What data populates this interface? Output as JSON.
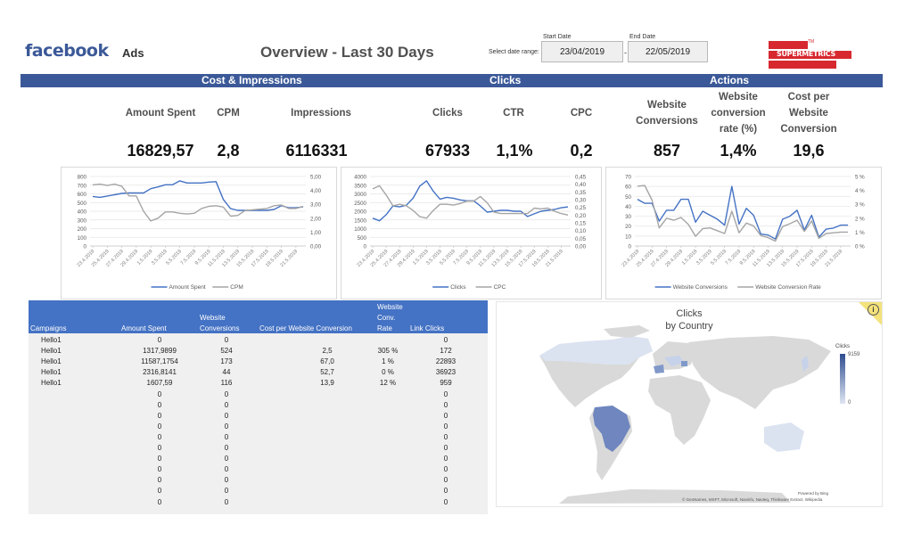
{
  "header": {
    "logo_text": "facebook",
    "product": "Ads",
    "title": "Overview - Last 30 Days",
    "date_range_label": "Select date range:",
    "start_date_label": "Start Date",
    "end_date_label": "End Date",
    "start_date": "23/04/2019",
    "end_date": "22/05/2019",
    "separator": "-",
    "partner_logo": "SUPERMETRICS",
    "partner_tm": "TM"
  },
  "sections": [
    "Cost & Impressions",
    "Clicks",
    "Actions"
  ],
  "kpis": [
    {
      "label": "Amount Spent",
      "value": "16829,57"
    },
    {
      "label": "CPM",
      "value": "2,8"
    },
    {
      "label": "Impressions",
      "value": "6116331"
    },
    {
      "label": "Clicks",
      "value": "67933"
    },
    {
      "label": "CTR",
      "value": "1,1%"
    },
    {
      "label": "CPC",
      "value": "0,2"
    },
    {
      "label": "Website Conversions",
      "value": "857"
    },
    {
      "label": "Website conversion rate (%)",
      "value": "1,4%"
    },
    {
      "label": "Cost per Website Conversion",
      "value": "19,6"
    }
  ],
  "colors": {
    "brand": "#3b5998",
    "series_primary": "#4472c4",
    "series_secondary": "#a5a5a5",
    "table_header": "#4472c4",
    "supermetrics_red": "#d7282f"
  },
  "chart_data": [
    {
      "type": "line",
      "title": "",
      "x_tick_labels": [
        "23.4.2019",
        "25.4.2019",
        "27.4.2019",
        "29.4.2019",
        "1.5.2019",
        "3.5.2019",
        "5.5.2019",
        "7.5.2019",
        "9.5.2019",
        "11.5.2019",
        "13.5.2019",
        "15.5.2019",
        "17.5.2019",
        "19.5.2019",
        "21.5.2019"
      ],
      "x": [
        "23.4.2019",
        "24.4.2019",
        "25.4.2019",
        "26.4.2019",
        "27.4.2019",
        "28.4.2019",
        "29.4.2019",
        "30.4.2019",
        "1.5.2019",
        "2.5.2019",
        "3.5.2019",
        "4.5.2019",
        "5.5.2019",
        "6.5.2019",
        "7.5.2019",
        "8.5.2019",
        "9.5.2019",
        "10.5.2019",
        "11.5.2019",
        "12.5.2019",
        "13.5.2019",
        "14.5.2019",
        "15.5.2019",
        "16.5.2019",
        "17.5.2019",
        "18.5.2019",
        "19.5.2019",
        "20.5.2019",
        "21.5.2019",
        "22.5.2019"
      ],
      "y_left": {
        "ticks": [
          "0",
          "100",
          "200",
          "300",
          "400",
          "500",
          "600",
          "700",
          "800"
        ],
        "range": [
          0,
          800
        ]
      },
      "y_right": {
        "ticks": [
          "0,00",
          "1,00",
          "2,00",
          "3,00",
          "4,00",
          "5,00"
        ],
        "range": [
          0,
          5
        ]
      },
      "legend": "bottom",
      "series": [
        {
          "name": "Amount Spent",
          "axis": "left",
          "values": [
            570,
            560,
            575,
            590,
            605,
            610,
            610,
            610,
            660,
            680,
            705,
            705,
            750,
            725,
            725,
            725,
            735,
            740,
            535,
            430,
            410,
            410,
            410,
            410,
            410,
            420,
            465,
            440,
            440,
            450
          ]
        },
        {
          "name": "CPM",
          "axis": "right",
          "values": [
            4.4,
            4.45,
            4.35,
            4.45,
            4.3,
            3.6,
            3.6,
            2.5,
            1.8,
            2.0,
            2.45,
            2.45,
            2.35,
            2.3,
            2.35,
            2.7,
            2.85,
            2.9,
            2.8,
            2.15,
            2.2,
            2.55,
            2.6,
            2.65,
            2.7,
            2.9,
            2.95,
            2.7,
            2.7,
            2.85
          ]
        }
      ]
    },
    {
      "type": "line",
      "title": "",
      "x_tick_labels": [
        "23.4.2019",
        "25.4.2019",
        "27.4.2019",
        "29.4.2019",
        "1.5.2019",
        "3.5.2019",
        "5.5.2019",
        "7.5.2019",
        "9.5.2019",
        "11.5.2019",
        "13.5.2019",
        "15.5.2019",
        "17.5.2019",
        "19.5.2019",
        "21.5.2019"
      ],
      "x": [
        "23.4.2019",
        "24.4.2019",
        "25.4.2019",
        "26.4.2019",
        "27.4.2019",
        "28.4.2019",
        "29.4.2019",
        "30.4.2019",
        "1.5.2019",
        "2.5.2019",
        "3.5.2019",
        "4.5.2019",
        "5.5.2019",
        "6.5.2019",
        "7.5.2019",
        "8.5.2019",
        "9.5.2019",
        "10.5.2019",
        "11.5.2019",
        "12.5.2019",
        "13.5.2019",
        "14.5.2019",
        "15.5.2019",
        "16.5.2019",
        "17.5.2019",
        "18.5.2019",
        "19.5.2019",
        "20.5.2019",
        "21.5.2019",
        "22.5.2019"
      ],
      "y_left": {
        "ticks": [
          "0",
          "500",
          "1000",
          "1500",
          "2000",
          "2500",
          "3000",
          "3500",
          "4000"
        ],
        "range": [
          0,
          4000
        ]
      },
      "y_right": {
        "ticks": [
          "0,00",
          "0,05",
          "0,10",
          "0,15",
          "0,20",
          "0,25",
          "0,30",
          "0,35",
          "0,40",
          "0,45"
        ],
        "range": [
          0,
          0.45
        ]
      },
      "legend": "bottom",
      "series": [
        {
          "name": "Clicks",
          "axis": "left",
          "values": [
            1600,
            1450,
            1800,
            2300,
            2250,
            2350,
            2750,
            3450,
            3750,
            3150,
            2700,
            2800,
            2750,
            2650,
            2600,
            2600,
            2300,
            1950,
            2000,
            2050,
            2050,
            2000,
            2000,
            1700,
            1850,
            2000,
            2050,
            2100,
            2200,
            2250
          ]
        },
        {
          "name": "CPC",
          "axis": "right",
          "values": [
            0.37,
            0.39,
            0.33,
            0.26,
            0.27,
            0.26,
            0.23,
            0.19,
            0.18,
            0.23,
            0.27,
            0.27,
            0.265,
            0.275,
            0.29,
            0.29,
            0.32,
            0.28,
            0.22,
            0.21,
            0.21,
            0.21,
            0.21,
            0.21,
            0.245,
            0.24,
            0.245,
            0.225,
            0.21,
            0.2
          ]
        }
      ]
    },
    {
      "type": "line",
      "title": "",
      "x_tick_labels": [
        "23.4.2019",
        "25.4.2019",
        "27.4.2019",
        "29.4.2019",
        "1.5.2019",
        "3.5.2019",
        "5.5.2019",
        "7.5.2019",
        "9.5.2019",
        "11.5.2019",
        "13.5.2019",
        "15.5.2019",
        "17.5.2019",
        "19.5.2019",
        "21.5.2019"
      ],
      "x": [
        "23.4.2019",
        "24.4.2019",
        "25.4.2019",
        "26.4.2019",
        "27.4.2019",
        "28.4.2019",
        "29.4.2019",
        "30.4.2019",
        "1.5.2019",
        "2.5.2019",
        "3.5.2019",
        "4.5.2019",
        "5.5.2019",
        "6.5.2019",
        "7.5.2019",
        "8.5.2019",
        "9.5.2019",
        "10.5.2019",
        "11.5.2019",
        "12.5.2019",
        "13.5.2019",
        "14.5.2019",
        "15.5.2019",
        "16.5.2019",
        "17.5.2019",
        "18.5.2019",
        "19.5.2019",
        "20.5.2019",
        "21.5.2019",
        "22.5.2019"
      ],
      "y_left": {
        "ticks": [
          "0",
          "10",
          "20",
          "30",
          "40",
          "50",
          "60",
          "70"
        ],
        "range": [
          0,
          70
        ]
      },
      "y_right": {
        "ticks": [
          "0 %",
          "1 %",
          "2 %",
          "3 %",
          "4 %",
          "5 %"
        ],
        "range": [
          0,
          5
        ]
      },
      "legend": "bottom",
      "series": [
        {
          "name": "Website Conversions",
          "axis": "left",
          "values": [
            47,
            43,
            43,
            25,
            36,
            36,
            47,
            47,
            24,
            35,
            31,
            27,
            21,
            60,
            22,
            38,
            31,
            12,
            11,
            7,
            27,
            30,
            36,
            16,
            31,
            9,
            17,
            18,
            21,
            21
          ]
        },
        {
          "name": "Website Conversion Rate",
          "axis": "right",
          "values": [
            4.3,
            4.35,
            3.3,
            1.3,
            2.0,
            1.85,
            2.05,
            1.55,
            0.7,
            1.25,
            1.3,
            1.1,
            0.9,
            2.5,
            0.95,
            1.65,
            1.45,
            0.75,
            0.6,
            0.35,
            1.4,
            1.6,
            1.85,
            1.05,
            1.8,
            0.55,
            0.9,
            0.95,
            1.0,
            1.0
          ]
        }
      ]
    }
  ],
  "table": {
    "columns": [
      "Campaigns",
      "Amount Spent",
      "Website Conversions",
      "Cost per Website Conversion",
      "Website Conv. Rate",
      "Link Clicks"
    ],
    "column_lines": [
      [
        "Campaigns"
      ],
      [
        "Amount Spent"
      ],
      [
        "Website",
        "Conversions"
      ],
      [
        "Cost per Website Conversion"
      ],
      [
        "Website",
        "Conv.",
        "Rate"
      ],
      [
        "Link Clicks"
      ]
    ],
    "rows": [
      [
        "Hello1",
        "0",
        "0",
        "",
        "",
        "0"
      ],
      [
        "Hello1",
        "1317,9899",
        "524",
        "2,5",
        "305 %",
        "172"
      ],
      [
        "Hello1",
        "11587,1754",
        "173",
        "67,0",
        "1 %",
        "22893"
      ],
      [
        "Hello1",
        "2316,8141",
        "44",
        "52,7",
        "0 %",
        "36923"
      ],
      [
        "Hello1",
        "1607,59",
        "116",
        "13,9",
        "12 %",
        "959"
      ],
      [
        "",
        "0",
        "0",
        "",
        "",
        "0"
      ],
      [
        "",
        "0",
        "0",
        "",
        "",
        "0"
      ],
      [
        "",
        "0",
        "0",
        "",
        "",
        "0"
      ],
      [
        "",
        "0",
        "0",
        "",
        "",
        "0"
      ],
      [
        "",
        "0",
        "0",
        "",
        "",
        "0"
      ],
      [
        "",
        "0",
        "0",
        "",
        "",
        "0"
      ],
      [
        "",
        "0",
        "0",
        "",
        "",
        "0"
      ],
      [
        "",
        "0",
        "0",
        "",
        "",
        "0"
      ],
      [
        "",
        "0",
        "0",
        "",
        "",
        "0"
      ],
      [
        "",
        "0",
        "0",
        "",
        "",
        "0"
      ],
      [
        "",
        "0",
        "0",
        "",
        "",
        "0"
      ]
    ]
  },
  "map": {
    "title_line1": "Clicks",
    "title_line2": "by Country",
    "legend_title": "Clicks",
    "legend_max": "9159",
    "legend_min": "0",
    "powered_by": "Powered by Bing",
    "attribution": "© GeoNames, MSFT, Microsoft, Navinfo, Navteq, Thinkware Extract, Wikipedia",
    "info_icon": "i",
    "highlighted_countries": [
      {
        "name": "Brazil",
        "level": "high"
      },
      {
        "name": "Spain",
        "level": "medium"
      },
      {
        "name": "Romania",
        "level": "medium"
      },
      {
        "name": "Canada",
        "level": "low"
      },
      {
        "name": "Australia",
        "level": "low"
      },
      {
        "name": "Japan",
        "level": "low"
      },
      {
        "name": "Poland",
        "level": "low"
      },
      {
        "name": "France",
        "level": "low"
      }
    ]
  }
}
